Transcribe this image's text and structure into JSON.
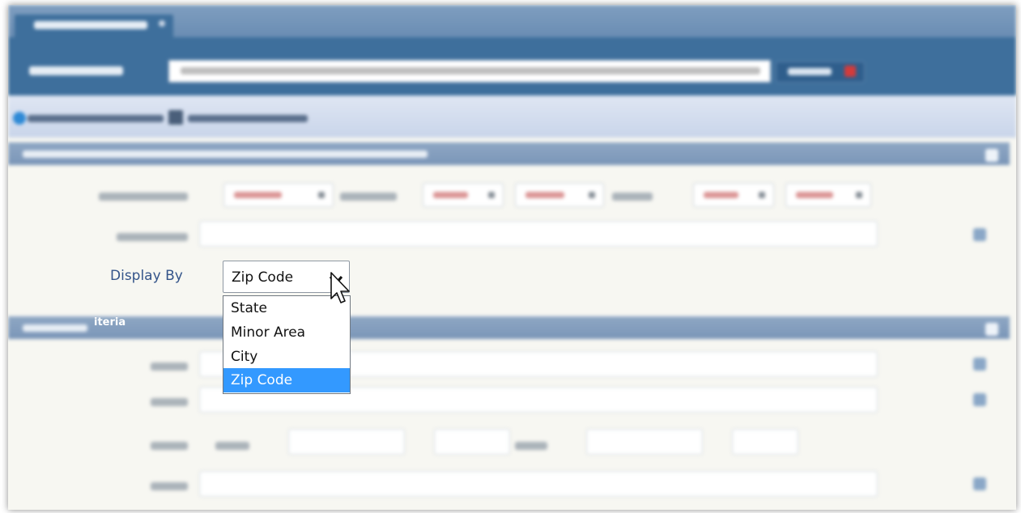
{
  "form": {
    "display_by_label": "Display By",
    "display_by_value": "Zip Code"
  },
  "dropdown": {
    "options": [
      "State",
      "Minor Area",
      "City",
      "Zip Code"
    ],
    "selected": "Zip Code"
  },
  "sections": {
    "criteria_partial": "iteria"
  },
  "colors": {
    "header": "#3e6f9c",
    "section": "#7b96b8",
    "label": "#34548a",
    "selection": "#3399ff"
  },
  "icons": [
    "chevron-down-icon",
    "mouse-pointer-icon",
    "plus-icon",
    "collapse-icon",
    "search-icon",
    "save-icon"
  ]
}
